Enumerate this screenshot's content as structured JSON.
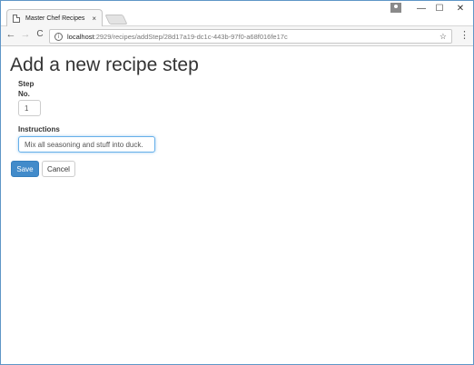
{
  "browser": {
    "tab_title": "Master Chef Recipes",
    "tab_close": "×",
    "url_host": "localhost",
    "url_path": ":2929/recipes/addStep/28d17a19-dc1c-443b-97f0-a68f016fe17c",
    "icons": [
      "page-icon",
      "profile-icon",
      "minimize-icon",
      "maximize-icon",
      "close-icon",
      "back-icon",
      "forward-icon",
      "reload-icon",
      "info-icon",
      "star-icon",
      "menu-icon"
    ]
  },
  "window_controls": {
    "minimize": "—",
    "maximize": "☐",
    "close": "✕"
  },
  "nav": {
    "back": "←",
    "forward": "→",
    "reload": "C",
    "menu": "⋮",
    "star": "☆",
    "info": "i"
  },
  "page": {
    "title": "Add a new recipe step",
    "step_label_line1": "Step",
    "step_label_line2": "No.",
    "step_value": "1",
    "instructions_label": "Instructions",
    "instructions_value": "Mix all seasoning and stuff into duck.",
    "save_label": "Save",
    "cancel_label": "Cancel"
  },
  "colors": {
    "primary": "#428bca",
    "focus": "#66afe9",
    "window_border": "#5f96c7"
  }
}
